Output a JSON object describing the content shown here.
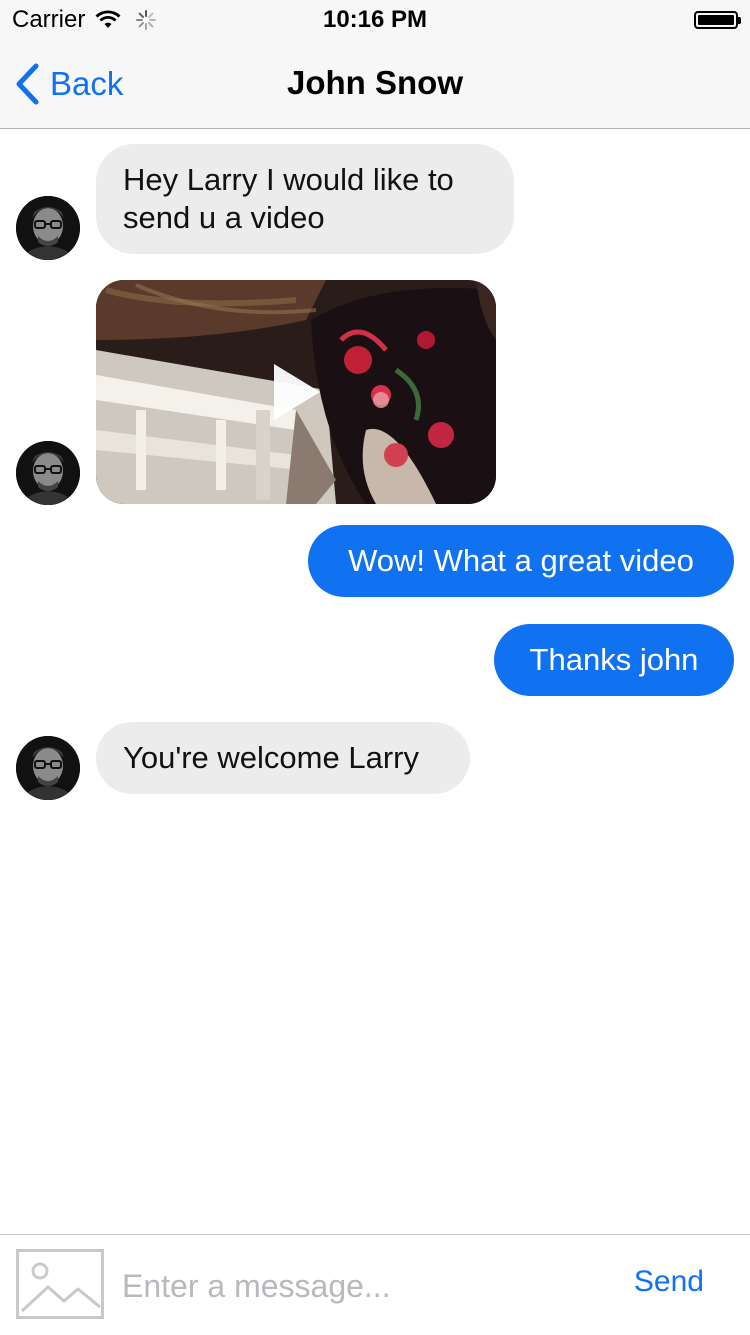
{
  "status_bar": {
    "carrier": "Carrier",
    "time": "10:16 PM"
  },
  "nav": {
    "back_label": "Back",
    "title": "John Snow"
  },
  "messages": [
    {
      "direction": "incoming",
      "type": "text",
      "text": "Hey Larry I would like to send u a video"
    },
    {
      "direction": "incoming",
      "type": "video",
      "icon": "play-icon"
    },
    {
      "direction": "outgoing",
      "type": "text",
      "text": "Wow! What a great video"
    },
    {
      "direction": "outgoing",
      "type": "text",
      "text": "Thanks john"
    },
    {
      "direction": "incoming",
      "type": "text",
      "text": "You're welcome Larry"
    }
  ],
  "composer": {
    "placeholder": "Enter a message...",
    "value": "",
    "send_label": "Send",
    "image_icon": "image-placeholder-icon"
  },
  "colors": {
    "accent": "#1172f1",
    "incoming_bubble": "#ececec",
    "outgoing_bubble": "#1172f1",
    "bar_background": "#f7f7f7"
  }
}
